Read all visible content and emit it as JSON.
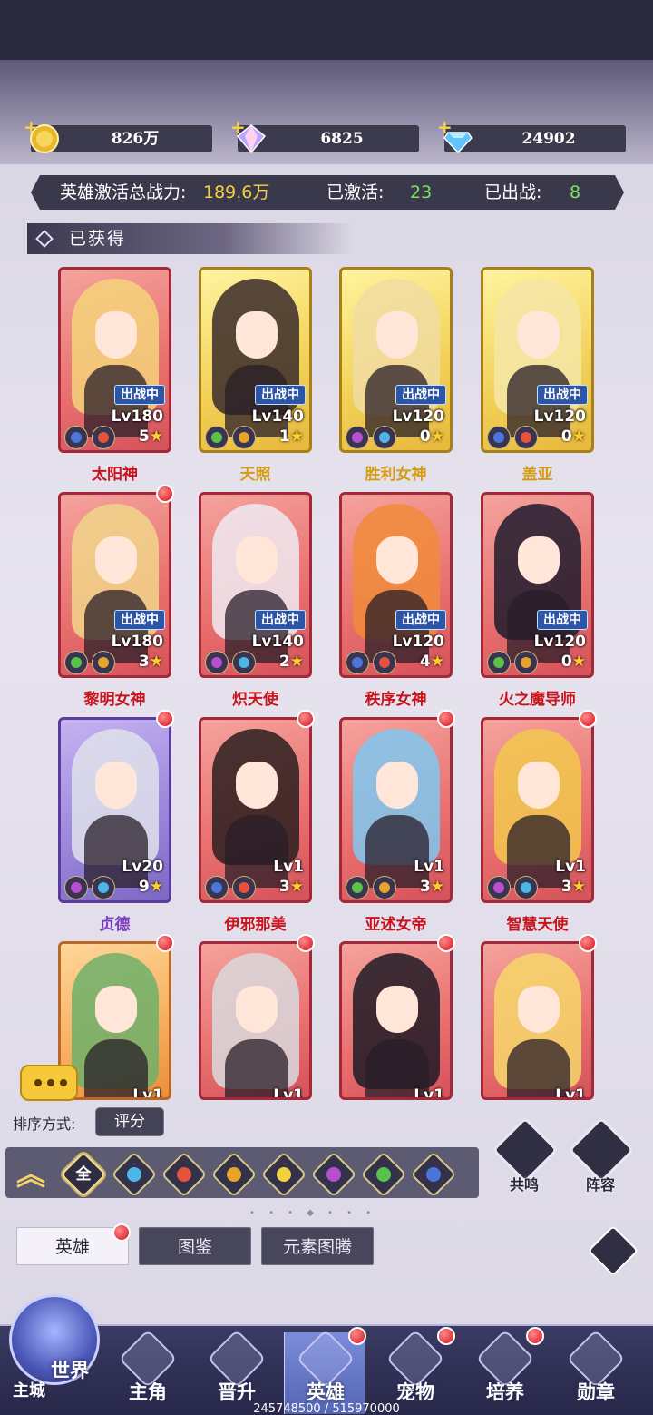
{
  "currencies": [
    {
      "value": "826万",
      "icon": "gold-coin-icon"
    },
    {
      "value": "6825",
      "icon": "rainbow-crystal-icon"
    },
    {
      "value": "24902",
      "icon": "blue-diamond-icon"
    }
  ],
  "stats": {
    "power_label": "英雄激活总战力:",
    "power_value": "189.6万",
    "activated_label": "已激活:",
    "activated_value": "23",
    "deployed_label": "已出战:",
    "deployed_value": "8"
  },
  "section_title": "已获得",
  "heroes": [
    {
      "name": "太阳神",
      "level": "Lv180",
      "stars": "5",
      "badge": "出战中",
      "frame": "red",
      "new": false
    },
    {
      "name": "天照",
      "level": "Lv140",
      "stars": "1",
      "badge": "出战中",
      "frame": "gold",
      "new": false
    },
    {
      "name": "胜利女神",
      "level": "Lv120",
      "stars": "0",
      "badge": "出战中",
      "frame": "gold",
      "new": false
    },
    {
      "name": "盖亚",
      "level": "Lv120",
      "stars": "0",
      "badge": "出战中",
      "frame": "gold",
      "new": false
    },
    {
      "name": "黎明女神",
      "level": "Lv180",
      "stars": "3",
      "badge": "出战中",
      "frame": "red",
      "new": true
    },
    {
      "name": "炽天使",
      "level": "Lv140",
      "stars": "2",
      "badge": "出战中",
      "frame": "red",
      "new": false
    },
    {
      "name": "秩序女神",
      "level": "Lv120",
      "stars": "4",
      "badge": "出战中",
      "frame": "red",
      "new": false
    },
    {
      "name": "火之魔导师",
      "level": "Lv120",
      "stars": "0",
      "badge": "出战中",
      "frame": "red",
      "new": false
    },
    {
      "name": "贞德",
      "level": "Lv20",
      "stars": "9",
      "badge": "",
      "frame": "purple",
      "new": true
    },
    {
      "name": "伊邪那美",
      "level": "Lv1",
      "stars": "3",
      "badge": "",
      "frame": "red",
      "new": true
    },
    {
      "name": "亚述女帝",
      "level": "Lv1",
      "stars": "3",
      "badge": "",
      "frame": "red",
      "new": true
    },
    {
      "name": "智慧天使",
      "level": "Lv1",
      "stars": "3",
      "badge": "",
      "frame": "red",
      "new": true
    },
    {
      "name": "",
      "level": "Lv1",
      "stars": "",
      "badge": "",
      "frame": "orange",
      "new": true
    },
    {
      "name": "",
      "level": "Lv1",
      "stars": "",
      "badge": "",
      "frame": "red",
      "new": true
    },
    {
      "name": "",
      "level": "Lv1",
      "stars": "",
      "badge": "",
      "frame": "red",
      "new": true
    },
    {
      "name": "",
      "level": "Lv1",
      "stars": "",
      "badge": "",
      "frame": "red",
      "new": true
    }
  ],
  "sort": {
    "label": "排序方式:",
    "value": "评分"
  },
  "filters": {
    "all_label": "全",
    "elements": [
      "wind-icon",
      "fire-icon",
      "earth-icon",
      "light-icon",
      "dark-icon",
      "nature-icon",
      "star-icon"
    ]
  },
  "side_buttons": [
    {
      "label": "共鸣",
      "icon": "resonance-icon"
    },
    {
      "label": "阵容",
      "icon": "lineup-icon"
    }
  ],
  "tabs": [
    {
      "label": "英雄",
      "active": true
    },
    {
      "label": "图鉴",
      "active": false
    },
    {
      "label": "元素图腾",
      "active": false
    }
  ],
  "nav": {
    "world_label": "世界",
    "city_label": "主城",
    "items": [
      {
        "label": "主角"
      },
      {
        "label": "晋升"
      },
      {
        "label": "英雄"
      },
      {
        "label": "宠物"
      },
      {
        "label": "培养"
      },
      {
        "label": "勋章"
      }
    ]
  },
  "progress_text": "245748500 / 515970000",
  "colors": {
    "accent_yellow": "#f5d142",
    "accent_green": "#7ee05b",
    "hero_name_red": "#c8141c"
  }
}
